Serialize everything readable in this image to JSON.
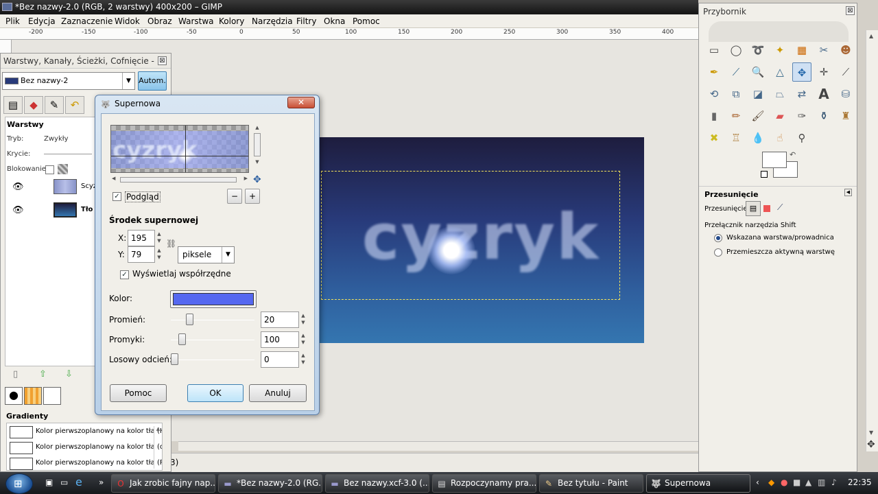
{
  "window": {
    "title": "*Bez nazwy-2.0 (RGB, 2 warstwy) 400x200 – GIMP"
  },
  "menu": [
    "Plik",
    "Edycja",
    "Zaznaczenie",
    "Widok",
    "Obraz",
    "Warstwa",
    "Kolory",
    "Narzędzia",
    "Filtry",
    "Okna",
    "Pomoc"
  ],
  "ruler": [
    "-200",
    "-150",
    "-100",
    "-50",
    "0",
    "50",
    "100",
    "150",
    "200",
    "250",
    "300",
    "350",
    "400"
  ],
  "canvas": {
    "image_text": "cyzryk",
    "colors": {
      "top": "#1e1d3e",
      "bottom": "#3476b0"
    }
  },
  "dock": {
    "title": "Warstwy, Kanały, Ścieżki, Cofnięcie - Pę...",
    "image_combo": "Bez nazwy-2",
    "auto_button": "Autom.",
    "layers_title": "Warstwy",
    "mode_label": "Tryb:",
    "mode_value": "Zwykły",
    "opacity_label": "Krycie:",
    "lock_label": "Blokowanie:",
    "layers": [
      {
        "name": "Scyz"
      },
      {
        "name": "Tło"
      }
    ],
    "gradients_title": "Gradienty",
    "gradients": [
      "Kolor pierwszoplanowy na kolor tła (H",
      "Kolor pierwszoplanowy na kolor tła (o",
      "Kolor pierwszoplanowy na kolor tła (R"
    ]
  },
  "status": {
    "fragment": "3)"
  },
  "dialog": {
    "title": "Supernowa",
    "preview_label": "Podgląd",
    "preview_checked": true,
    "section_title": "Środek supernowej",
    "x_label": "X:",
    "x_value": "195",
    "y_label": "Y:",
    "y_value": "79",
    "unit": "piksele",
    "show_coords_label": "Wyświetlaj współrzędne",
    "show_coords_checked": true,
    "color_label": "Kolor:",
    "color_value": "#5568f0",
    "radius_label": "Promień:",
    "radius_value": "20",
    "spokes_label": "Promyki:",
    "spokes_value": "100",
    "hue_label": "Losowy odcień:",
    "hue_value": "0",
    "help_button": "Pomoc",
    "ok_button": "OK",
    "cancel_button": "Anuluj"
  },
  "toolbox": {
    "title": "Przybornik",
    "tool_options_title": "Przesunięcie",
    "move_label": "Przesunięcie:",
    "switch_label": "Przełącznik narzędzia  Shift",
    "option_1": "Wskazana warstwa/prowadnica",
    "option_2": "Przemieszcza aktywną warstwę"
  },
  "taskbar": {
    "items": [
      "Jak zrobic fajny nap...",
      "*Bez nazwy-2.0 (RG...",
      "Bez nazwy.xcf-3.0 (...",
      "Rozpoczynamy pra...",
      "Bez tytułu - Paint",
      "Supernowa"
    ],
    "clock": "22:35"
  }
}
